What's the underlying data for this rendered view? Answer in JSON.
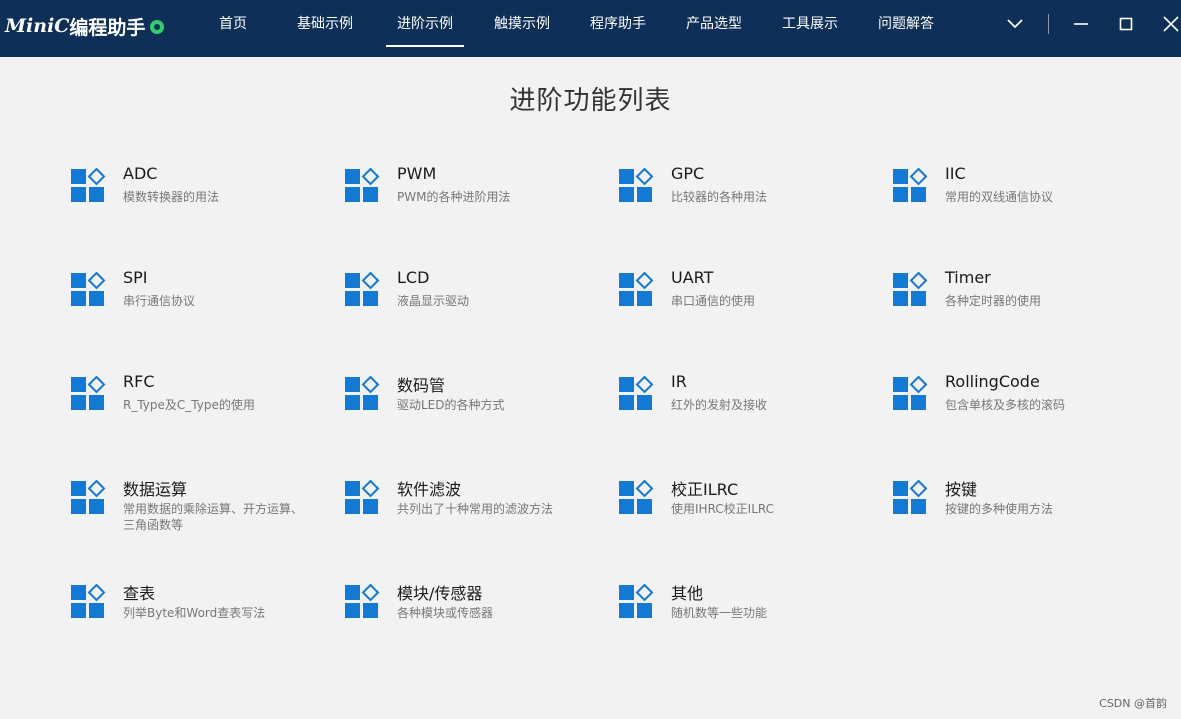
{
  "app": {
    "logo_text_a": "MiniC",
    "logo_text_b": "编程助手",
    "logo_icon": "green-gear-icon"
  },
  "nav": {
    "items": [
      {
        "label": "首页",
        "active": false
      },
      {
        "label": "基础示例",
        "active": false
      },
      {
        "label": "进阶示例",
        "active": true
      },
      {
        "label": "触摸示例",
        "active": false
      },
      {
        "label": "程序助手",
        "active": false
      },
      {
        "label": "产品选型",
        "active": false
      },
      {
        "label": "工具展示",
        "active": false
      },
      {
        "label": "问题解答",
        "active": false
      }
    ]
  },
  "window_controls": [
    "chevron-down-icon",
    "minimize-icon",
    "maximize-icon",
    "close-icon"
  ],
  "page": {
    "title": "进阶功能列表"
  },
  "features": [
    {
      "title": "ADC",
      "desc": "模数转换器的用法"
    },
    {
      "title": "PWM",
      "desc": "PWM的各种进阶用法"
    },
    {
      "title": "GPC",
      "desc": "比较器的各种用法"
    },
    {
      "title": "IIC",
      "desc": "常用的双线通信协议"
    },
    {
      "title": "SPI",
      "desc": "串行通信协议"
    },
    {
      "title": "LCD",
      "desc": "液晶显示驱动"
    },
    {
      "title": "UART",
      "desc": "串口通信的使用"
    },
    {
      "title": "Timer",
      "desc": "各种定时器的使用"
    },
    {
      "title": "RFC",
      "desc": "R_Type及C_Type的使用"
    },
    {
      "title": "数码管",
      "desc": "驱动LED的各种方式"
    },
    {
      "title": "IR",
      "desc": "红外的发射及接收"
    },
    {
      "title": "RollingCode",
      "desc": "包含单核及多核的滚码"
    },
    {
      "title": "数据运算",
      "desc": "常用数据的乘除运算、开方运算、三角函数等"
    },
    {
      "title": "软件滤波",
      "desc": "共列出了十种常用的滤波方法"
    },
    {
      "title": "校正ILRC",
      "desc": "使用IHRC校正ILRC"
    },
    {
      "title": "按键",
      "desc": "按键的多种使用方法"
    },
    {
      "title": "查表",
      "desc": "列举Byte和Word查表写法"
    },
    {
      "title": "模块/传感器",
      "desc": "各种模块或传感器"
    },
    {
      "title": "其他",
      "desc": "随机数等一些功能"
    }
  ],
  "colors": {
    "topbar": "#0e2f57",
    "background": "#f2f2f3",
    "icon_blue": "#1279d4"
  },
  "watermark": "CSDN @首韵"
}
